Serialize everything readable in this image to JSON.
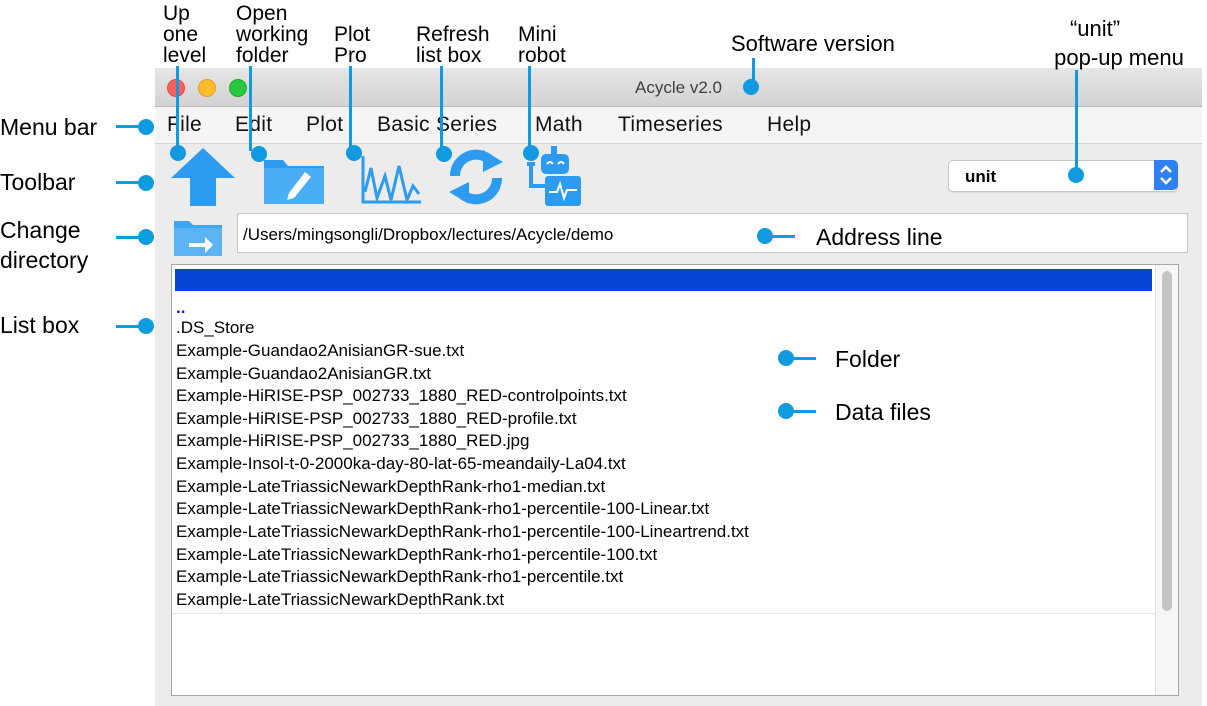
{
  "window": {
    "title": "Acycle v2.0"
  },
  "menu": [
    "File",
    "Edit",
    "Plot",
    "Basic Series",
    "Math",
    "Timeseries",
    "Help"
  ],
  "toolbar": {
    "icons": [
      "up-arrow-icon",
      "open-folder-icon",
      "plot-pro-icon",
      "refresh-icon",
      "mini-robot-icon"
    ],
    "unit_select": {
      "value": "unit",
      "accent_color": "#2f80f7"
    }
  },
  "address": {
    "path": "/Users/mingsongli/Dropbox/lectures/Acycle/demo"
  },
  "listbox": {
    "selection_color": "#0645d6",
    "parent_entry": "..",
    "files": [
      ".DS_Store",
      "Example-Guandao2AnisianGR-sue.txt",
      "Example-Guandao2AnisianGR.txt",
      "Example-HiRISE-PSP_002733_1880_RED-controlpoints.txt",
      "Example-HiRISE-PSP_002733_1880_RED-profile.txt",
      "Example-HiRISE-PSP_002733_1880_RED.jpg",
      "Example-Insol-t-0-2000ka-day-80-lat-65-meandaily-La04.txt",
      "Example-LateTriassicNewarkDepthRank-rho1-median.txt",
      "Example-LateTriassicNewarkDepthRank-rho1-percentile-100-Linear.txt",
      "Example-LateTriassicNewarkDepthRank-rho1-percentile-100-Lineartrend.txt",
      "Example-LateTriassicNewarkDepthRank-rho1-percentile-100.txt",
      "Example-LateTriassicNewarkDepthRank-rho1-percentile.txt",
      "Example-LateTriassicNewarkDepthRank.txt"
    ]
  },
  "annotations": {
    "top": [
      {
        "lines": [
          "Up",
          "one",
          "level"
        ]
      },
      {
        "lines": [
          "Open",
          "working",
          "folder"
        ]
      },
      {
        "lines": [
          "Plot",
          "Pro"
        ]
      },
      {
        "lines": [
          "Refresh",
          "list box"
        ]
      },
      {
        "lines": [
          "Mini",
          "robot"
        ]
      }
    ],
    "software_version": "Software version",
    "unit_menu": [
      "“unit”",
      "pop-up menu"
    ],
    "left": {
      "menu_bar": "Menu bar",
      "toolbar": "Toolbar",
      "change_directory": [
        "Change",
        "directory"
      ],
      "list_box": "List box"
    },
    "address_line": "Address line",
    "folder": "Folder",
    "data_files": "Data files",
    "accent_color": "#109be0"
  }
}
